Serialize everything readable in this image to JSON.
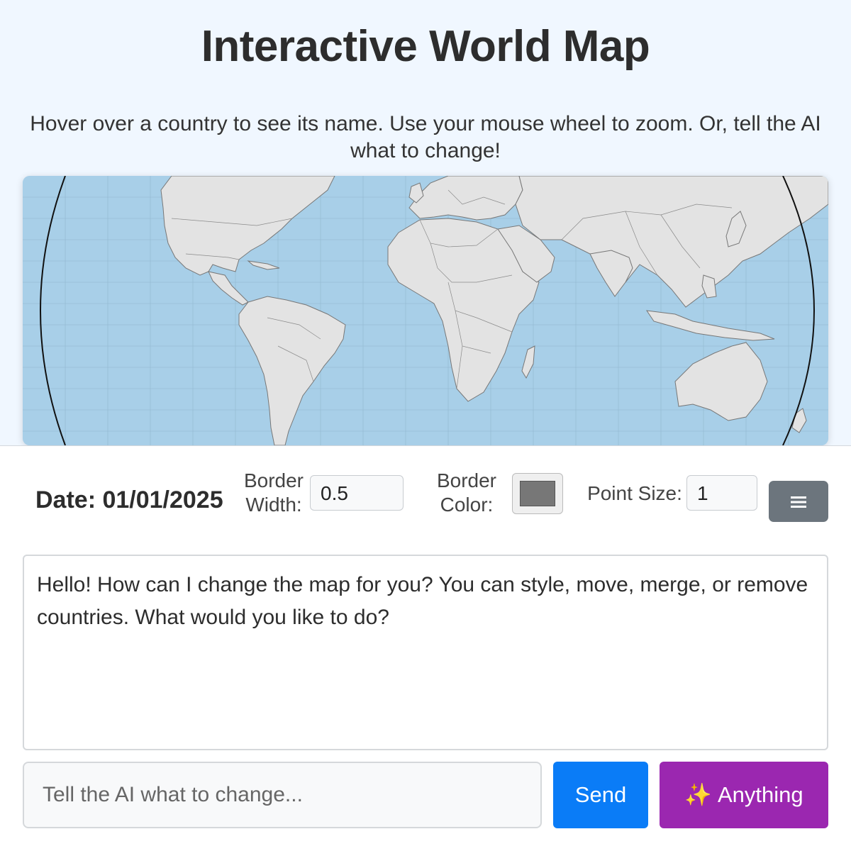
{
  "header": {
    "title": "Interactive World Map",
    "subtitle": "Hover over a country to see its name. Use your mouse wheel to zoom. Or, tell the AI what to change!"
  },
  "map": {
    "ocean_color": "#a8cfe8",
    "land_color": "#e3e3e3",
    "border_color": "#777777"
  },
  "controls": {
    "date_label": "Date: 01/01/2025",
    "border_width_label_line1": "Border",
    "border_width_label_line2": "Width:",
    "border_width_value": "0.5",
    "border_color_label_line1": "Border",
    "border_color_label_line2": "Color:",
    "border_color_value": "#777777",
    "point_size_label": "Point Size:",
    "point_size_value": "1",
    "menu_icon": "hamburger-menu-icon"
  },
  "chat": {
    "message": "Hello! How can I change the map for you? You can style, move, merge, or remove countries. What would you like to do?",
    "input_placeholder": "Tell the AI what to change...",
    "send_label": "Send",
    "anything_label": "Anything",
    "anything_icon": "sparkles-icon"
  },
  "colors": {
    "send_button": "#0a7cf7",
    "anything_button": "#9b27b0",
    "menu_button": "#6c757d"
  }
}
